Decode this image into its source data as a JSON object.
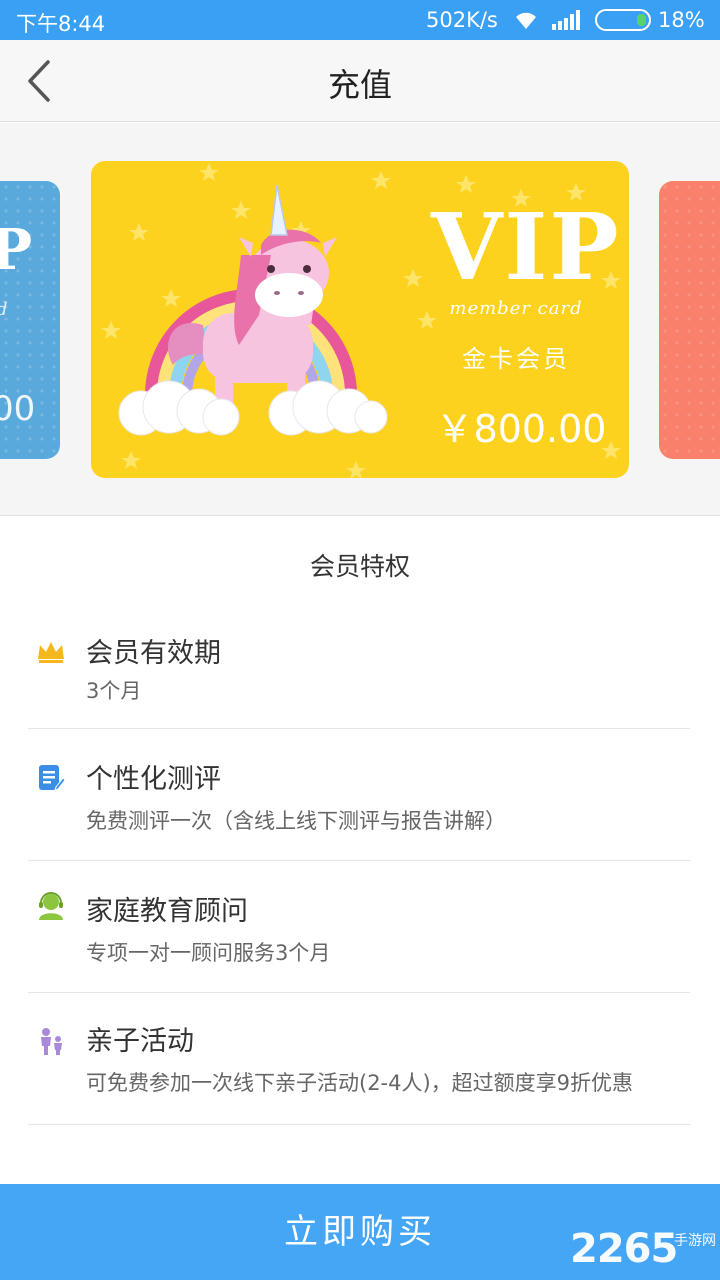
{
  "status_bar": {
    "time": "下午8:44",
    "network_speed": "502K/s",
    "battery_percent": "18%",
    "icons": [
      "wifi-icon",
      "signal-icon",
      "battery-icon"
    ]
  },
  "nav": {
    "title": "充值",
    "back_icon": "chevron-left-icon"
  },
  "carousel": {
    "cards": [
      {
        "partial_vip": "P",
        "partial_member": "d",
        "partial_price": "00",
        "color": "#5aa9dc"
      },
      {
        "vip": "VIP",
        "member_card": "member card",
        "tier_name": "金卡会员",
        "price": "￥800.00",
        "color": "#fdd21f",
        "art": "unicorn-rainbow"
      },
      {
        "color": "#f9806a"
      }
    ]
  },
  "privileges": {
    "title": "会员特权",
    "items": [
      {
        "icon": "crown-icon",
        "title": "会员有效期",
        "desc": "3个月",
        "icon_color": "#f5b81c"
      },
      {
        "icon": "document-edit-icon",
        "title": "个性化测评",
        "desc": "免费测评一次（含线上线下测评与报告讲解）",
        "icon_color": "#3a8ee6"
      },
      {
        "icon": "advisor-icon",
        "title": "家庭教育顾问",
        "desc": "专项一对一顾问服务3个月",
        "icon_color": "#8cc63e"
      },
      {
        "icon": "family-icon",
        "title": "亲子活动",
        "desc": "可免费参加一次线下亲子活动(2-4人)，超过额度享9折优惠",
        "icon_color": "#a98ad8"
      }
    ]
  },
  "buy_button": {
    "label": "立即购买",
    "color": "#44a6f5"
  },
  "watermark": {
    "number": "2265",
    "site": "手游网"
  }
}
